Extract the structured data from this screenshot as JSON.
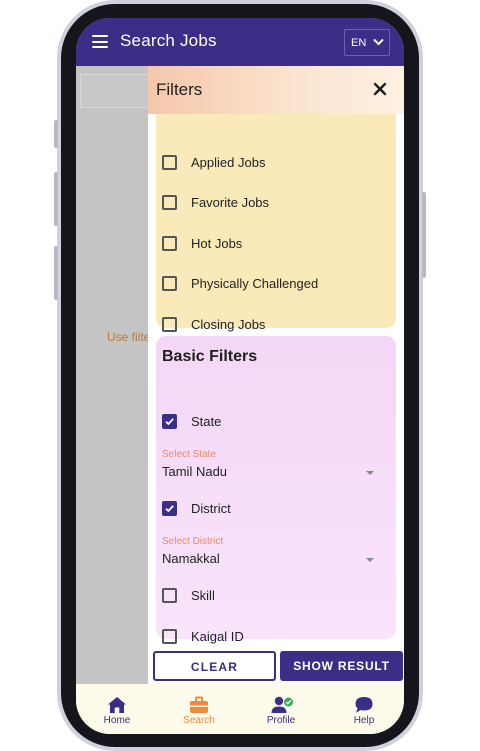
{
  "appbar": {
    "title": "Search Jobs",
    "language": "EN"
  },
  "background": {
    "hint_text": "Use filters"
  },
  "filters": {
    "title": "Filters",
    "quick_filters": [
      {
        "label": "Applied Jobs",
        "checked": false
      },
      {
        "label": "Favorite Jobs",
        "checked": false
      },
      {
        "label": "Hot Jobs",
        "checked": false
      },
      {
        "label": "Physically Challenged",
        "checked": false
      },
      {
        "label": "Closing Jobs",
        "checked": false
      }
    ],
    "basic": {
      "title": "Basic Filters",
      "state": {
        "label": "State",
        "checked": true,
        "select_label": "Select State",
        "value": "Tamil Nadu"
      },
      "district": {
        "label": "District",
        "checked": true,
        "select_label": "Select District",
        "value": "Namakkal"
      },
      "skill": {
        "label": "Skill",
        "checked": false
      },
      "kaigal_id": {
        "label": "Kaigal ID",
        "checked": false
      }
    },
    "actions": {
      "clear": "CLEAR",
      "show_result": "SHOW RESULT"
    }
  },
  "nav": {
    "items": [
      {
        "label": "Home",
        "icon": "home-icon",
        "active": false
      },
      {
        "label": "Search",
        "icon": "briefcase-icon",
        "active": true
      },
      {
        "label": "Profile",
        "icon": "profile-icon",
        "active": false
      },
      {
        "label": "Help",
        "icon": "chat-icon",
        "active": false
      }
    ]
  },
  "colors": {
    "primary": "#3b2e86",
    "accent": "#f0883e",
    "quick_card": "#faeab9",
    "basic_card": "#f4d7f6",
    "nav_bg": "#fffbea"
  }
}
